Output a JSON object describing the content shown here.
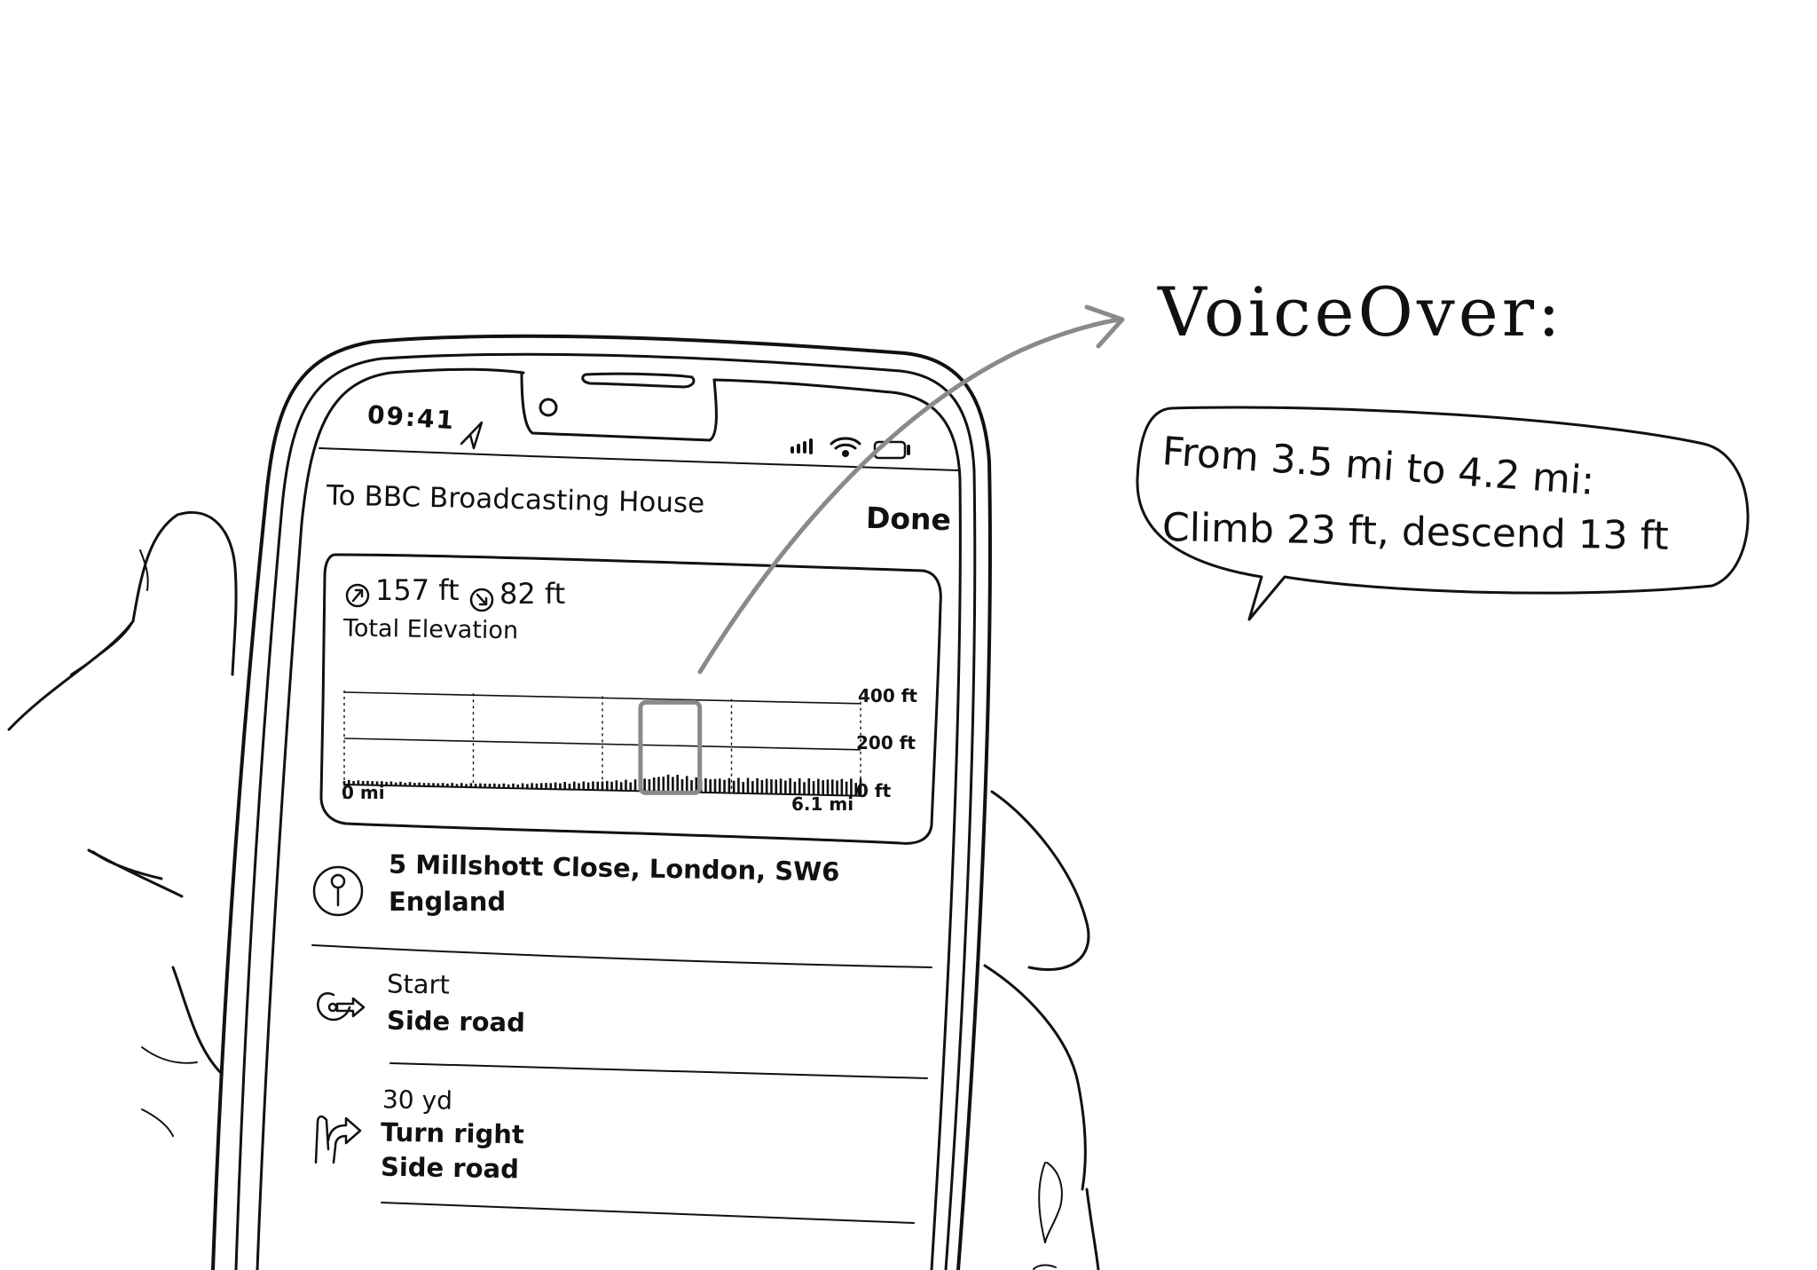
{
  "status_bar": {
    "time": "09:41",
    "icons": [
      "location-arrow-icon",
      "cellular-signal-icon",
      "wifi-icon",
      "battery-icon"
    ]
  },
  "nav": {
    "title": "To BBC Broadcasting House",
    "done_label": "Done"
  },
  "elevation": {
    "ascent": "157 ft",
    "descent": "82 ft",
    "ascent_icon": "ascent-arrow-icon",
    "descent_icon": "descent-arrow-icon",
    "label": "Total Elevation"
  },
  "chart_data": {
    "type": "bar",
    "title": "",
    "x_start_label": "0 mi",
    "x_end_label": "6.1 mi",
    "y_tick_labels": [
      "400 ft",
      "200 ft",
      "0 ft"
    ],
    "xlim": [
      0,
      6.1
    ],
    "ylim": [
      0,
      400
    ],
    "grid": true,
    "x_units": "mi",
    "y_units": "ft",
    "highlighted_range": [
      3.5,
      4.2
    ],
    "profile": [
      {
        "x": 0.0,
        "y": 18
      },
      {
        "x": 1.0,
        "y": 14
      },
      {
        "x": 2.0,
        "y": 18
      },
      {
        "x": 3.0,
        "y": 35
      },
      {
        "x": 3.5,
        "y": 45
      },
      {
        "x": 3.85,
        "y": 68
      },
      {
        "x": 4.2,
        "y": 55
      },
      {
        "x": 5.0,
        "y": 60
      },
      {
        "x": 6.1,
        "y": 65
      }
    ]
  },
  "route_steps": [
    {
      "icon": "pin-icon",
      "lines": [
        "5 Millshott Close, London, SW6",
        "England"
      ]
    },
    {
      "icon": "start-arrow-icon",
      "lines": [
        "Start",
        "Side road"
      ]
    },
    {
      "icon": "turn-right-icon",
      "lines": [
        "30 yd",
        "Turn right",
        "Side road"
      ]
    }
  ],
  "voiceover": {
    "title": "VoiceOver:",
    "line1": "From 3.5 mi to 4.2 mi:",
    "line2": "Climb 23 ft, descend 13 ft"
  },
  "colors": {
    "ink": "#111111",
    "highlight": "#8a8a8a",
    "background": "#ffffff"
  }
}
